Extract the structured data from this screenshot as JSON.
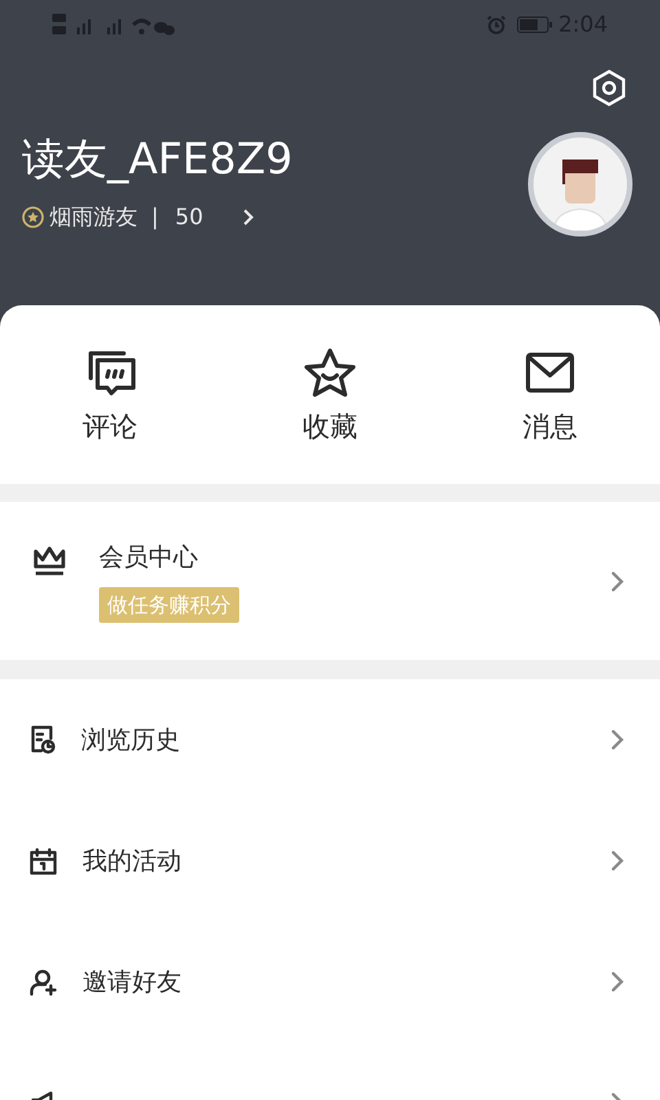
{
  "status_bar": {
    "time": "2:04"
  },
  "profile": {
    "username": "读友_AFE8Z9",
    "level_name": "烟雨游友",
    "separator": "|",
    "points": "50"
  },
  "quick_actions": [
    {
      "kind": "comment",
      "label": "评论"
    },
    {
      "kind": "favorite",
      "label": "收藏"
    },
    {
      "kind": "message",
      "label": "消息"
    }
  ],
  "member": {
    "title": "会员中心",
    "badge": "做任务赚积分"
  },
  "menu": [
    {
      "kind": "history",
      "label": "浏览历史"
    },
    {
      "kind": "activity",
      "label": "我的活动"
    },
    {
      "kind": "invite",
      "label": "邀请好友"
    },
    {
      "kind": "report"
    }
  ]
}
